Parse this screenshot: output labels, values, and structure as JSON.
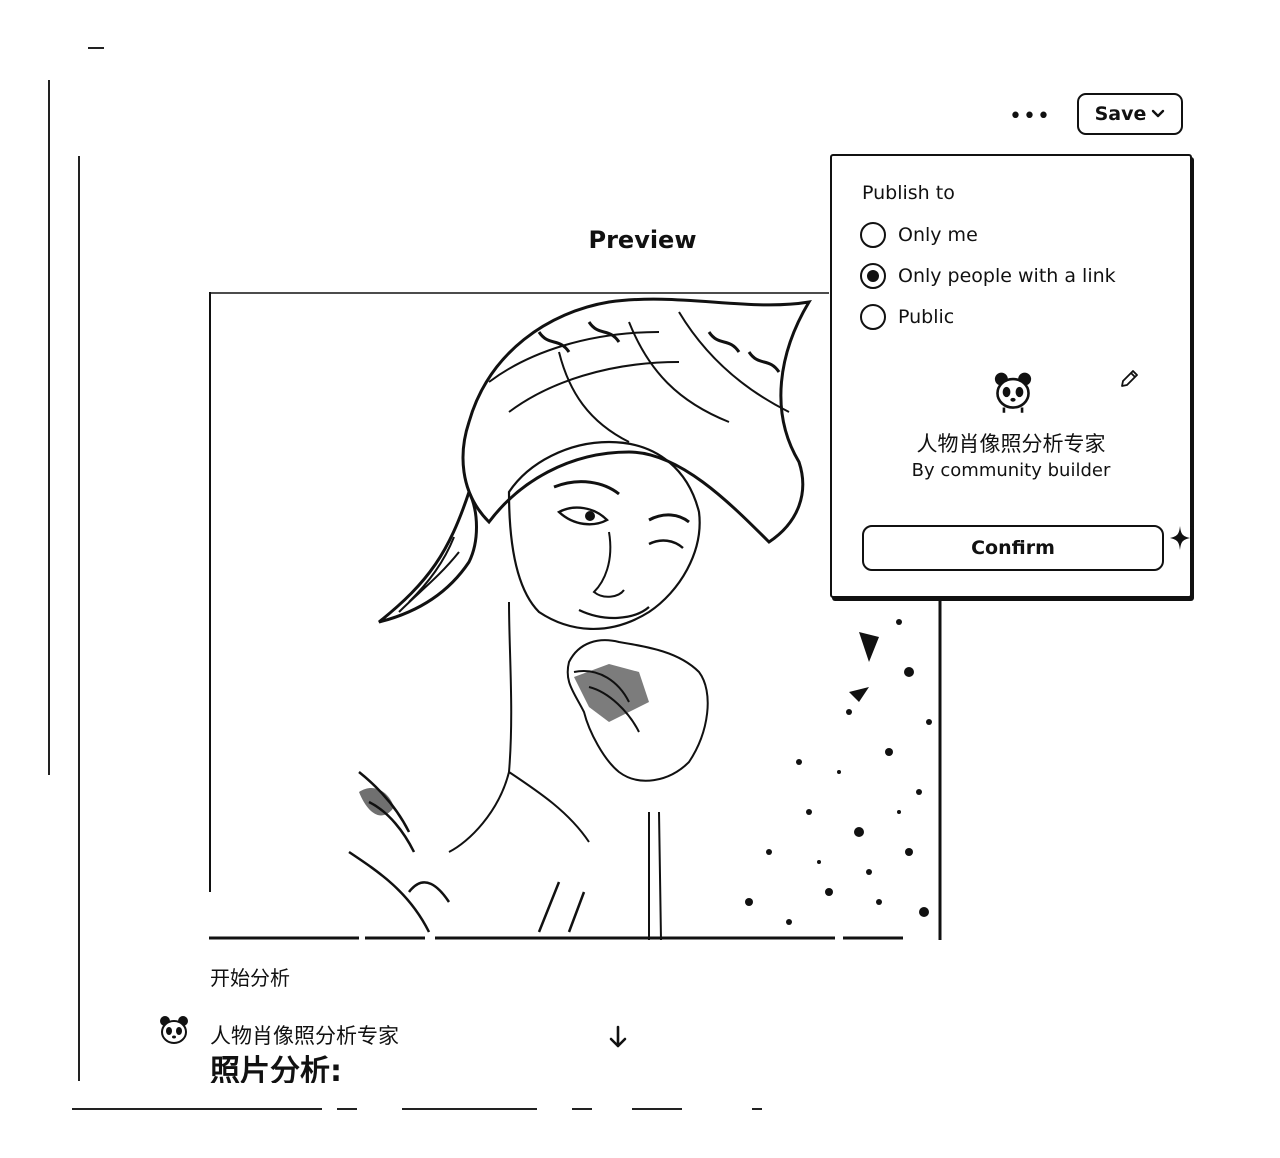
{
  "toolbar": {
    "more_label": "•••",
    "save_label": "Save"
  },
  "preview": {
    "title": "Preview",
    "start_prompt": "开始分析",
    "bot_name": "人物肖像照分析专家",
    "response_heading": "照片分析:"
  },
  "publish": {
    "label": "Publish to",
    "options": [
      {
        "label": "Only me",
        "selected": false
      },
      {
        "label": "Only people with a link",
        "selected": true
      },
      {
        "label": "Public",
        "selected": false
      }
    ],
    "gpt_name": "人物肖像照分析专家",
    "gpt_author": "By community builder",
    "confirm_label": "Confirm"
  },
  "icons": {
    "more": "ellipsis-icon",
    "save_chevron": "chevron-down-icon",
    "avatar": "panda-icon",
    "edit": "pencil-icon",
    "scroll": "arrow-down-icon",
    "sparkle": "sparkle-icon"
  }
}
